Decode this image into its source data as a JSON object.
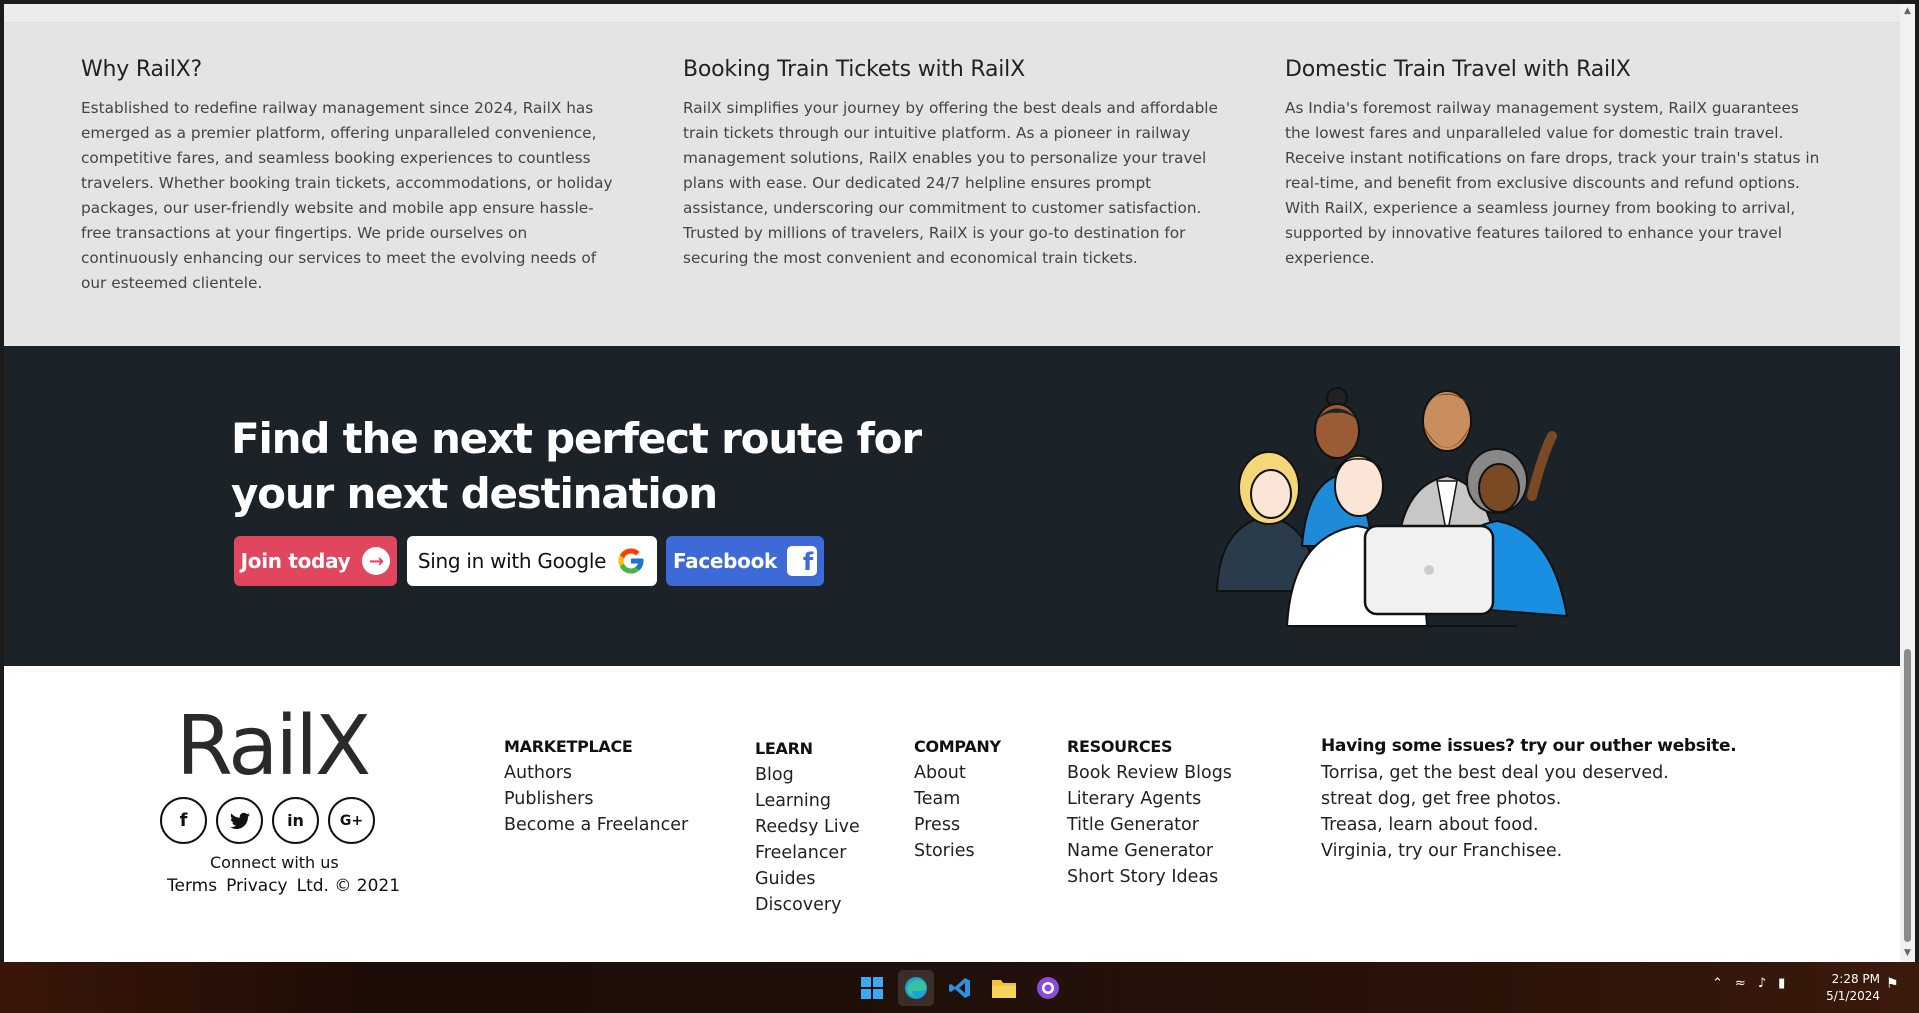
{
  "info": [
    {
      "title": "Why RailX?",
      "body": "Established to redefine railway management since 2024, RailX has emerged as a premier platform, offering unparalleled convenience, competitive fares, and seamless booking experiences to countless travelers. Whether booking train tickets, accommodations, or holiday packages, our user-friendly website and mobile app ensure hassle-free transactions at your fingertips. We pride ourselves on continuously enhancing our services to meet the evolving needs of our esteemed clientele."
    },
    {
      "title": "Booking Train Tickets with RailX",
      "body": "RailX simplifies your journey by offering the best deals and affordable train tickets through our intuitive platform. As a pioneer in railway management solutions, RailX enables you to personalize your travel plans with ease. Our dedicated 24/7 helpline ensures prompt assistance, underscoring our commitment to customer satisfaction. Trusted by millions of travelers, RailX is your go-to destination for securing the most convenient and economical train tickets."
    },
    {
      "title": "Domestic Train Travel with RailX",
      "body": "As India's foremost railway management system, RailX guarantees the lowest fares and unparalleled value for domestic train travel. Receive instant notifications on fare drops, track your train's status in real-time, and benefit from exclusive discounts and refund options. With RailX, experience a seamless journey from booking to arrival, supported by innovative features tailored to enhance your travel experience."
    }
  ],
  "hero": {
    "title": "Find the next perfect route for your next destination",
    "join_label": "Join today",
    "google_label": "Sing in with Google",
    "facebook_label": "Facebook",
    "colors": {
      "background": "#1b2329",
      "join": "#e1465f",
      "facebook": "#3d6ad6"
    }
  },
  "footer": {
    "brand": "RailX",
    "socials": [
      "facebook-icon",
      "twitter-icon",
      "linkedin-icon",
      "google-plus-icon"
    ],
    "connect": "Connect with us",
    "legal": [
      "Terms",
      "Privacy",
      "Ltd. © 2021"
    ],
    "marketplace": {
      "head": "MARKETPLACE",
      "links": [
        "Authors",
        "Publishers",
        "Become a Freelancer"
      ]
    },
    "learn": {
      "head": "LEARN",
      "links": [
        "Blog",
        "Learning",
        "Reedsy Live",
        "Freelancer",
        "Guides",
        "Discovery"
      ]
    },
    "company": {
      "head": "COMPANY",
      "links": [
        "About",
        "Team",
        "Press",
        "Stories"
      ]
    },
    "resources": {
      "head": "RESOURCES",
      "links": [
        "Book Review Blogs",
        "Literary Agents",
        "Title Generator",
        "Name Generator",
        "Short Story Ideas"
      ]
    },
    "issues": {
      "head": "Having some issues? try our outher website.",
      "links": [
        "Torrisa, get the best deal you deserved.",
        "streat dog, get free photos.",
        "Treasa, learn about food.",
        "Virginia, try our Franchisee."
      ]
    }
  },
  "taskbar": {
    "apps": [
      "windows-start-icon",
      "edge-icon",
      "vscode-icon",
      "file-explorer-icon",
      "github-desktop-icon"
    ],
    "time": "2:28 PM",
    "date": "5/1/2024"
  }
}
